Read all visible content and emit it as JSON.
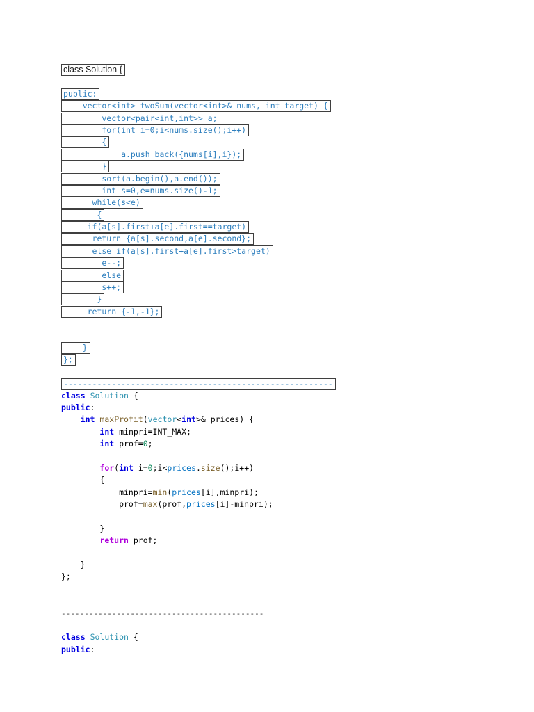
{
  "colors": {
    "boxed_text": "#2e7fbe",
    "box_border": "#3f3f3f",
    "sans_text": "#1a1a1a",
    "plain": "#000000",
    "keyword": "#0000e0",
    "control": "#af00db",
    "type": "#2b91af",
    "func": "#795e26",
    "number": "#098658",
    "variable": "#0070c1",
    "dash_plain": "#333333"
  },
  "rows": [
    {
      "type": "boxed-sans",
      "text": "class Solution {"
    },
    {
      "type": "blank"
    },
    {
      "type": "boxed",
      "text": "public:"
    },
    {
      "type": "boxed",
      "text": "    vector<int> twoSum(vector<int>& nums, int target) {"
    },
    {
      "type": "boxed",
      "text": "        vector<pair<int,int>> a;"
    },
    {
      "type": "boxed",
      "text": "        for(int i=0;i<nums.size();i++)"
    },
    {
      "type": "boxed",
      "text": "        {"
    },
    {
      "type": "boxed",
      "text": "            a.push_back({nums[i],i});"
    },
    {
      "type": "boxed",
      "text": "        }"
    },
    {
      "type": "boxed",
      "text": "        sort(a.begin(),a.end());"
    },
    {
      "type": "boxed",
      "text": "        int s=0,e=nums.size()-1;"
    },
    {
      "type": "boxed",
      "text": "      while(s<e)"
    },
    {
      "type": "boxed",
      "text": "       {"
    },
    {
      "type": "boxed",
      "text": "     if(a[s].first+a[e].first==target)"
    },
    {
      "type": "boxed",
      "text": "      return {a[s].second,a[e].second};"
    },
    {
      "type": "boxed",
      "text": "      else if(a[s].first+a[e].first>target)"
    },
    {
      "type": "boxed",
      "text": "        e--;"
    },
    {
      "type": "boxed",
      "text": "        else"
    },
    {
      "type": "boxed",
      "text": "        s++;"
    },
    {
      "type": "boxed",
      "text": "       }"
    },
    {
      "type": "boxed",
      "text": "     return {-1,-1};"
    },
    {
      "type": "blank"
    },
    {
      "type": "blank"
    },
    {
      "type": "boxed",
      "text": "    }"
    },
    {
      "type": "boxed",
      "text": "};"
    },
    {
      "type": "blank"
    },
    {
      "type": "boxed-dash",
      "text": "--------------------------------------------------------"
    },
    {
      "type": "code",
      "tokens": [
        [
          "k",
          "class"
        ],
        [
          "p",
          " "
        ],
        [
          "t",
          "Solution"
        ],
        [
          "p",
          " {"
        ]
      ]
    },
    {
      "type": "code",
      "tokens": [
        [
          "k",
          "public"
        ],
        [
          "p",
          ":"
        ]
      ]
    },
    {
      "type": "code",
      "tokens": [
        [
          "p",
          "    "
        ],
        [
          "k",
          "int"
        ],
        [
          "p",
          " "
        ],
        [
          "f",
          "maxProfit"
        ],
        [
          "p",
          "("
        ],
        [
          "t",
          "vector"
        ],
        [
          "p",
          "<"
        ],
        [
          "k",
          "int"
        ],
        [
          "p",
          ">& prices) {"
        ]
      ]
    },
    {
      "type": "code",
      "tokens": [
        [
          "p",
          "        "
        ],
        [
          "k",
          "int"
        ],
        [
          "p",
          " minpri=INT_MAX;"
        ]
      ]
    },
    {
      "type": "code",
      "tokens": [
        [
          "p",
          "        "
        ],
        [
          "k",
          "int"
        ],
        [
          "p",
          " prof="
        ],
        [
          "n",
          "0"
        ],
        [
          "p",
          ";"
        ]
      ]
    },
    {
      "type": "blank"
    },
    {
      "type": "code",
      "tokens": [
        [
          "p",
          "        "
        ],
        [
          "c",
          "for"
        ],
        [
          "p",
          "("
        ],
        [
          "k",
          "int"
        ],
        [
          "p",
          " i="
        ],
        [
          "n",
          "0"
        ],
        [
          "p",
          ";i<"
        ],
        [
          "v",
          "prices"
        ],
        [
          "p",
          "."
        ],
        [
          "f",
          "size"
        ],
        [
          "p",
          "();i++)"
        ]
      ]
    },
    {
      "type": "code",
      "tokens": [
        [
          "p",
          "        {"
        ]
      ]
    },
    {
      "type": "code",
      "tokens": [
        [
          "p",
          "            minpri="
        ],
        [
          "f",
          "min"
        ],
        [
          "p",
          "("
        ],
        [
          "v",
          "prices"
        ],
        [
          "p",
          "[i],minpri);"
        ]
      ]
    },
    {
      "type": "code",
      "tokens": [
        [
          "p",
          "            prof="
        ],
        [
          "f",
          "max"
        ],
        [
          "p",
          "(prof,"
        ],
        [
          "v",
          "prices"
        ],
        [
          "p",
          "[i]-minpri);"
        ]
      ]
    },
    {
      "type": "blank"
    },
    {
      "type": "code",
      "tokens": [
        [
          "p",
          "        }"
        ]
      ]
    },
    {
      "type": "code",
      "tokens": [
        [
          "p",
          "        "
        ],
        [
          "c",
          "return"
        ],
        [
          "p",
          " prof;"
        ]
      ]
    },
    {
      "type": "blank"
    },
    {
      "type": "code",
      "tokens": [
        [
          "p",
          "    }"
        ]
      ]
    },
    {
      "type": "code",
      "tokens": [
        [
          "p",
          "};"
        ]
      ]
    },
    {
      "type": "blank"
    },
    {
      "type": "blank"
    },
    {
      "type": "dash",
      "text": "--------------------------------------------"
    },
    {
      "type": "blank-short"
    },
    {
      "type": "code",
      "tokens": [
        [
          "k",
          "class"
        ],
        [
          "p",
          " "
        ],
        [
          "t",
          "Solution"
        ],
        [
          "p",
          " {"
        ]
      ]
    },
    {
      "type": "code",
      "tokens": [
        [
          "k",
          "public"
        ],
        [
          "p",
          ":"
        ]
      ]
    }
  ]
}
